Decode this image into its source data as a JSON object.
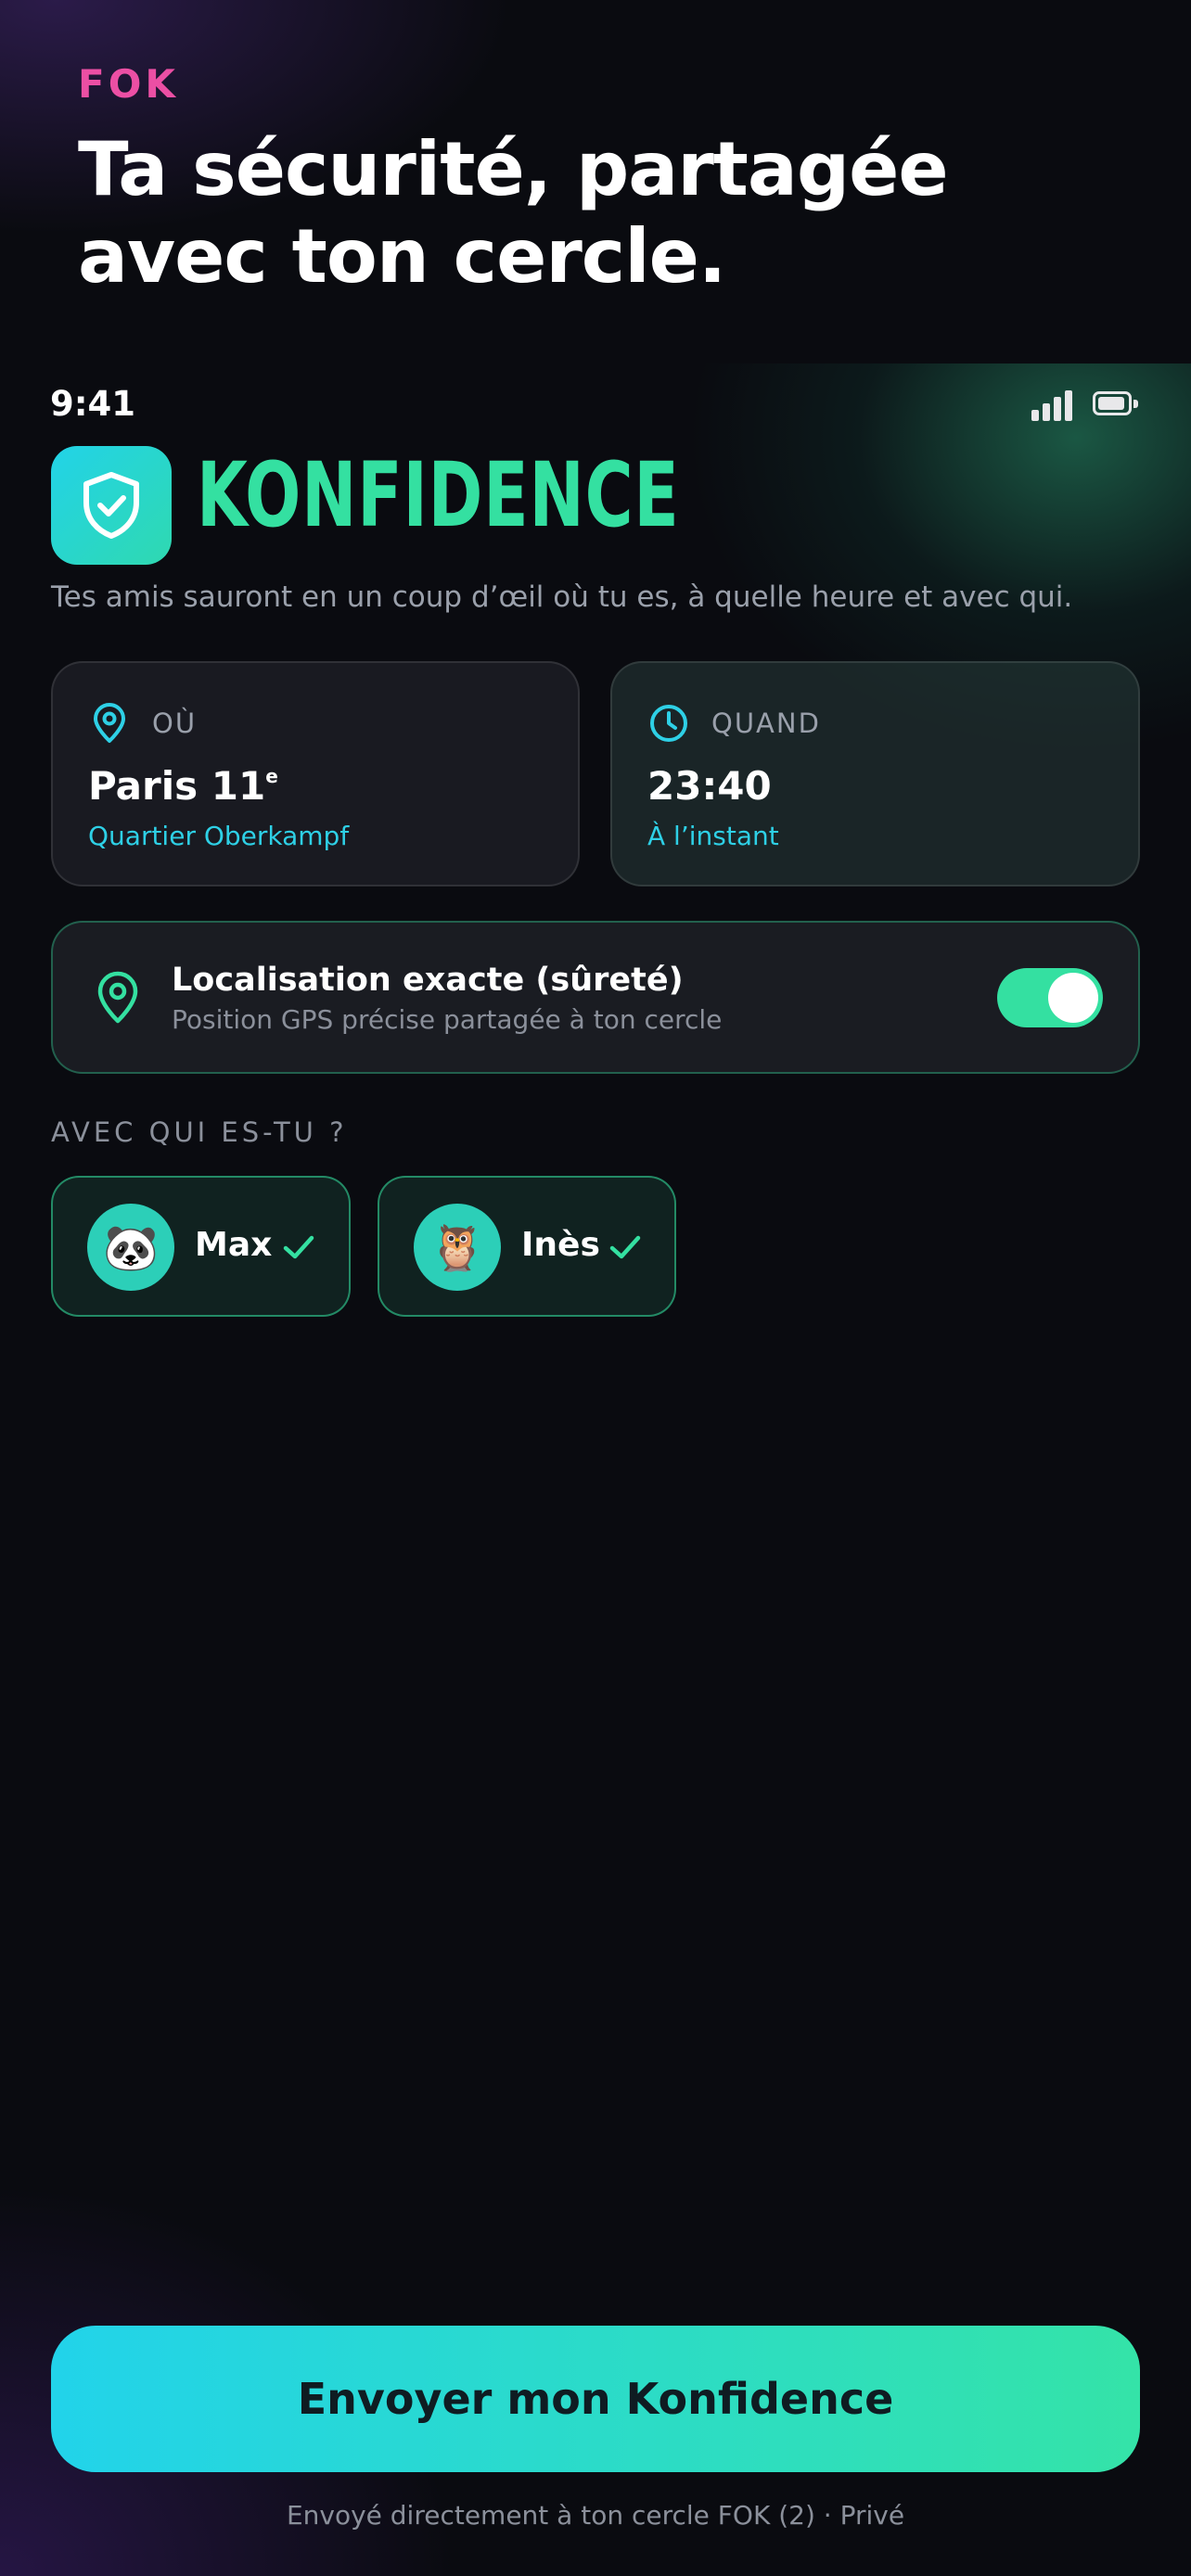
{
  "header": {
    "brand": "FOK",
    "headline": "Ta sécurité, partagée avec ton cercle."
  },
  "status_bar": {
    "time": "9:41",
    "icons": [
      "signal-icon",
      "battery-icon"
    ]
  },
  "app": {
    "logo_icon": "shield-check-icon",
    "title": "KONFIDENCE",
    "tagline": "Tes amis sauront en un coup d’œil où tu es, à quelle heure et avec qui."
  },
  "where_card": {
    "icon": "map-pin-icon",
    "label": "OÙ",
    "value": "Paris 11",
    "value_sup": "e",
    "sub": "Quartier Oberkampf"
  },
  "when_card": {
    "icon": "clock-icon",
    "label": "QUAND",
    "value": "23:40",
    "sub": "À l’instant"
  },
  "exact_location": {
    "icon": "map-pin-icon",
    "title": "Localisation exacte (sûreté)",
    "description": "Position GPS précise partagée à ton cercle",
    "enabled": true
  },
  "companions": {
    "label": "AVEC QUI ES-TU ?",
    "people": [
      {
        "name": "Max",
        "avatar": "🐼",
        "selected": true
      },
      {
        "name": "Inès",
        "avatar": "🦉",
        "selected": true
      }
    ]
  },
  "cta": {
    "label": "Envoyer mon Konfidence"
  },
  "footer": {
    "note": "Envoyé directement à ton cercle FOK (2) · Privé"
  },
  "colors": {
    "accent_green": "#34e0a1",
    "accent_cyan": "#22d3ea",
    "brand_pink": "#ec4fa4",
    "background": "#0a0b10"
  }
}
